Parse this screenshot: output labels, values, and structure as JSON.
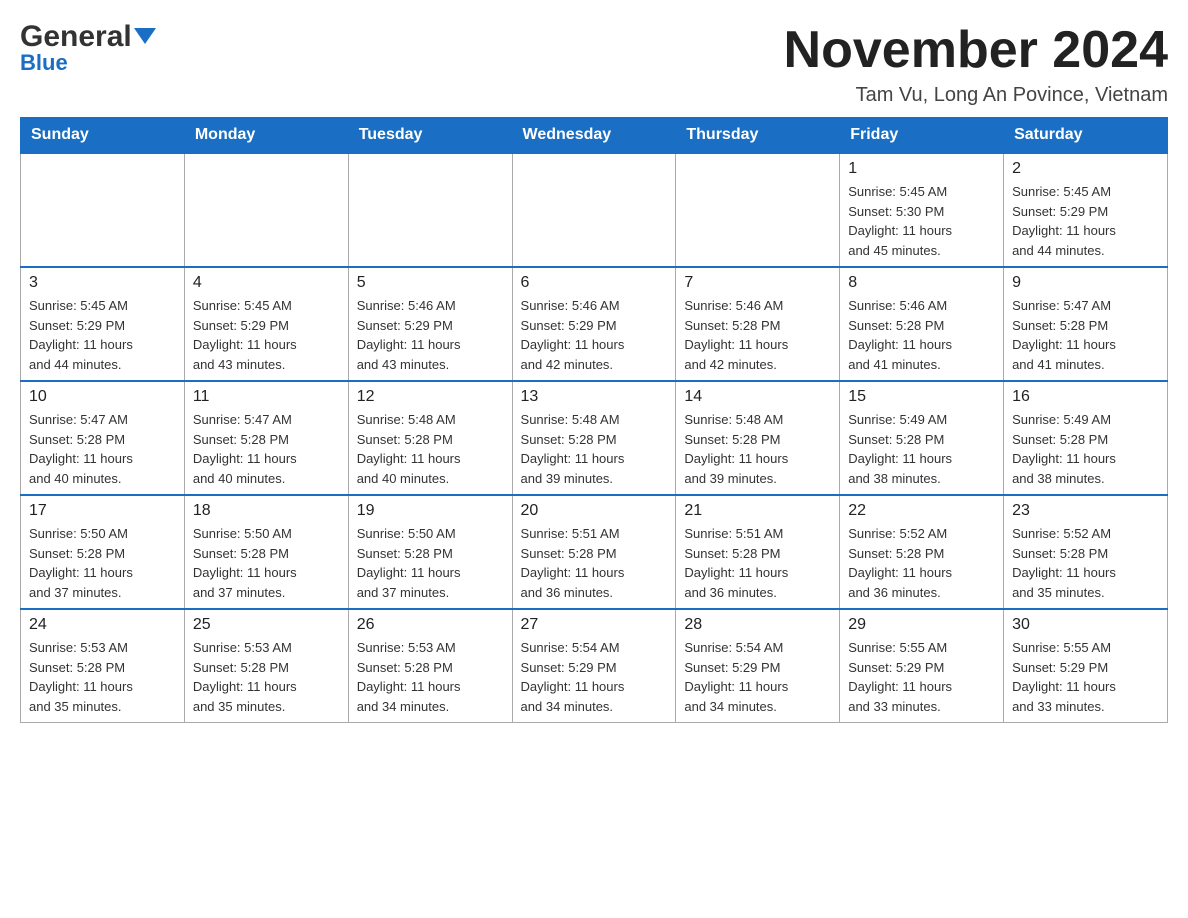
{
  "header": {
    "logo": {
      "general": "General",
      "blue": "Blue"
    },
    "title": "November 2024",
    "location": "Tam Vu, Long An Povince, Vietnam"
  },
  "calendar": {
    "days_of_week": [
      "Sunday",
      "Monday",
      "Tuesday",
      "Wednesday",
      "Thursday",
      "Friday",
      "Saturday"
    ],
    "weeks": [
      [
        {
          "day": "",
          "info": ""
        },
        {
          "day": "",
          "info": ""
        },
        {
          "day": "",
          "info": ""
        },
        {
          "day": "",
          "info": ""
        },
        {
          "day": "",
          "info": ""
        },
        {
          "day": "1",
          "info": "Sunrise: 5:45 AM\nSunset: 5:30 PM\nDaylight: 11 hours\nand 45 minutes."
        },
        {
          "day": "2",
          "info": "Sunrise: 5:45 AM\nSunset: 5:29 PM\nDaylight: 11 hours\nand 44 minutes."
        }
      ],
      [
        {
          "day": "3",
          "info": "Sunrise: 5:45 AM\nSunset: 5:29 PM\nDaylight: 11 hours\nand 44 minutes."
        },
        {
          "day": "4",
          "info": "Sunrise: 5:45 AM\nSunset: 5:29 PM\nDaylight: 11 hours\nand 43 minutes."
        },
        {
          "day": "5",
          "info": "Sunrise: 5:46 AM\nSunset: 5:29 PM\nDaylight: 11 hours\nand 43 minutes."
        },
        {
          "day": "6",
          "info": "Sunrise: 5:46 AM\nSunset: 5:29 PM\nDaylight: 11 hours\nand 42 minutes."
        },
        {
          "day": "7",
          "info": "Sunrise: 5:46 AM\nSunset: 5:28 PM\nDaylight: 11 hours\nand 42 minutes."
        },
        {
          "day": "8",
          "info": "Sunrise: 5:46 AM\nSunset: 5:28 PM\nDaylight: 11 hours\nand 41 minutes."
        },
        {
          "day": "9",
          "info": "Sunrise: 5:47 AM\nSunset: 5:28 PM\nDaylight: 11 hours\nand 41 minutes."
        }
      ],
      [
        {
          "day": "10",
          "info": "Sunrise: 5:47 AM\nSunset: 5:28 PM\nDaylight: 11 hours\nand 40 minutes."
        },
        {
          "day": "11",
          "info": "Sunrise: 5:47 AM\nSunset: 5:28 PM\nDaylight: 11 hours\nand 40 minutes."
        },
        {
          "day": "12",
          "info": "Sunrise: 5:48 AM\nSunset: 5:28 PM\nDaylight: 11 hours\nand 40 minutes."
        },
        {
          "day": "13",
          "info": "Sunrise: 5:48 AM\nSunset: 5:28 PM\nDaylight: 11 hours\nand 39 minutes."
        },
        {
          "day": "14",
          "info": "Sunrise: 5:48 AM\nSunset: 5:28 PM\nDaylight: 11 hours\nand 39 minutes."
        },
        {
          "day": "15",
          "info": "Sunrise: 5:49 AM\nSunset: 5:28 PM\nDaylight: 11 hours\nand 38 minutes."
        },
        {
          "day": "16",
          "info": "Sunrise: 5:49 AM\nSunset: 5:28 PM\nDaylight: 11 hours\nand 38 minutes."
        }
      ],
      [
        {
          "day": "17",
          "info": "Sunrise: 5:50 AM\nSunset: 5:28 PM\nDaylight: 11 hours\nand 37 minutes."
        },
        {
          "day": "18",
          "info": "Sunrise: 5:50 AM\nSunset: 5:28 PM\nDaylight: 11 hours\nand 37 minutes."
        },
        {
          "day": "19",
          "info": "Sunrise: 5:50 AM\nSunset: 5:28 PM\nDaylight: 11 hours\nand 37 minutes."
        },
        {
          "day": "20",
          "info": "Sunrise: 5:51 AM\nSunset: 5:28 PM\nDaylight: 11 hours\nand 36 minutes."
        },
        {
          "day": "21",
          "info": "Sunrise: 5:51 AM\nSunset: 5:28 PM\nDaylight: 11 hours\nand 36 minutes."
        },
        {
          "day": "22",
          "info": "Sunrise: 5:52 AM\nSunset: 5:28 PM\nDaylight: 11 hours\nand 36 minutes."
        },
        {
          "day": "23",
          "info": "Sunrise: 5:52 AM\nSunset: 5:28 PM\nDaylight: 11 hours\nand 35 minutes."
        }
      ],
      [
        {
          "day": "24",
          "info": "Sunrise: 5:53 AM\nSunset: 5:28 PM\nDaylight: 11 hours\nand 35 minutes."
        },
        {
          "day": "25",
          "info": "Sunrise: 5:53 AM\nSunset: 5:28 PM\nDaylight: 11 hours\nand 35 minutes."
        },
        {
          "day": "26",
          "info": "Sunrise: 5:53 AM\nSunset: 5:28 PM\nDaylight: 11 hours\nand 34 minutes."
        },
        {
          "day": "27",
          "info": "Sunrise: 5:54 AM\nSunset: 5:29 PM\nDaylight: 11 hours\nand 34 minutes."
        },
        {
          "day": "28",
          "info": "Sunrise: 5:54 AM\nSunset: 5:29 PM\nDaylight: 11 hours\nand 34 minutes."
        },
        {
          "day": "29",
          "info": "Sunrise: 5:55 AM\nSunset: 5:29 PM\nDaylight: 11 hours\nand 33 minutes."
        },
        {
          "day": "30",
          "info": "Sunrise: 5:55 AM\nSunset: 5:29 PM\nDaylight: 11 hours\nand 33 minutes."
        }
      ]
    ]
  }
}
